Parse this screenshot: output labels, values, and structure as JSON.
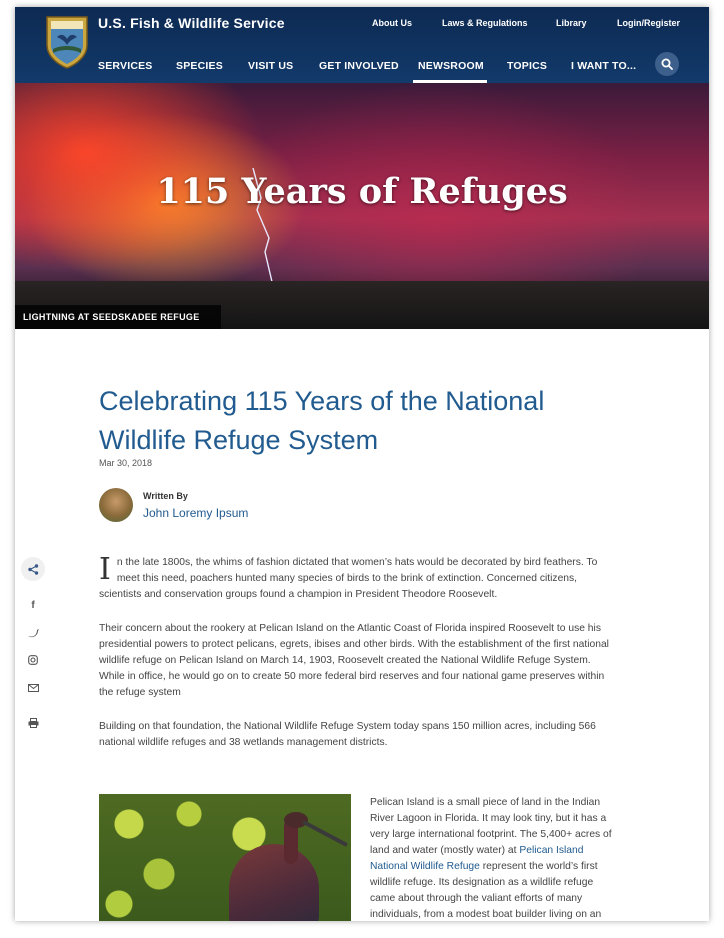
{
  "header": {
    "site_title": "U.S. Fish & Wildlife Service",
    "utility_nav": [
      "About Us",
      "Laws & Regulations",
      "Library",
      "Login/Register"
    ],
    "main_nav": [
      "SERVICES",
      "SPECIES",
      "VISIT US",
      "GET INVOLVED",
      "NEWSROOM",
      "TOPICS",
      "I WANT TO..."
    ],
    "active_nav": "NEWSROOM"
  },
  "hero": {
    "title": "115 Years of Refuges",
    "caption": "LIGHTNING AT SEEDSKADEE REFUGE"
  },
  "article": {
    "title": "Celebrating 115 Years of the National Wildlife Refuge System",
    "date": "Mar 30, 2018",
    "written_by_label": "Written By",
    "author": "John Loremy Ipsum",
    "dropcap": "I",
    "para1": "n the late 1800s, the whims of fashion dictated that women’s hats would be decorated by bird feathers. To meet this need, poachers hunted many species of birds to the brink of extinction. Concerned citizens, scientists and conservation groups found a champion in President Theodore Roosevelt.",
    "para2": "Their concern about the rookery at Pelican Island on the Atlantic Coast of Florida inspired Roosevelt to use his presidential powers to protect pelicans, egrets, ibises and other birds. With the establishment of the first national wildlife refuge on Pelican Island on March 14, 1903, Roosevelt created the National Wildlife Refuge System. While in office, he would go on to create 50 more federal bird reserves and four national game preserves within the refuge system",
    "para3": "Building on that foundation, the National Wildlife Refuge System today spans 150 million acres, including 566 national wildlife refuges and 38 wetlands management districts.",
    "side_text_before": "Pelican Island is a small piece of land in the Indian River Lagoon in Florida. It may look tiny, but it has a very large international footprint. The 5,400+ acres of land and water (mostly water) at ",
    "side_link": "Pelican Island National Wildlife Refuge",
    "side_text_after": " represent the world’s first wildlife refuge. Its designation as a wildlife refuge came about through the valiant efforts of many individuals, from a modest boat builder living on an"
  },
  "share": [
    "share-icon",
    "facebook-icon",
    "twitter-icon",
    "instagram-icon",
    "email-icon",
    "print-icon"
  ],
  "colors": {
    "header": "#123a6b",
    "accent": "#215b8f"
  }
}
